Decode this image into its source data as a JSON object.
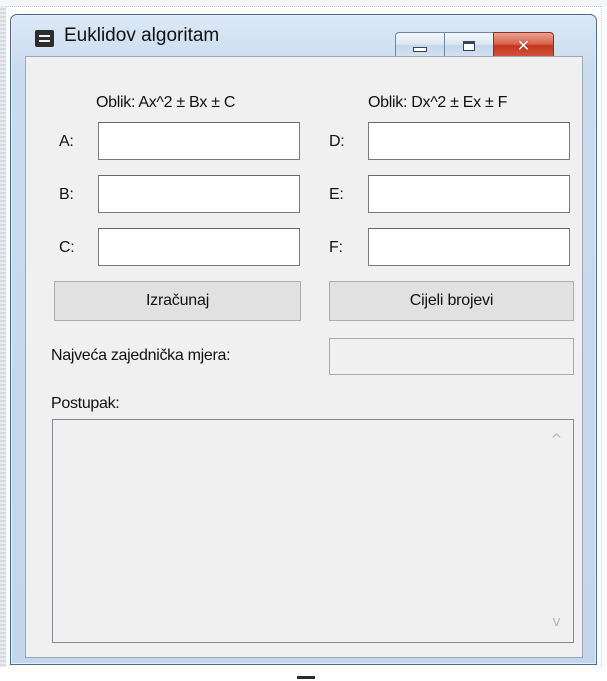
{
  "window": {
    "title": "Euklidov algoritam",
    "icons": {
      "app": "app-icon",
      "minimize": "minimize-icon",
      "maximize": "maximize-icon",
      "close": "close-icon"
    }
  },
  "labels": {
    "form_left": "Oblik: Ax^2 ± Bx ± C",
    "form_right": "Oblik: Dx^2 ± Ex ± F",
    "a": "A:",
    "b": "B:",
    "c": "C:",
    "d": "D:",
    "e": "E:",
    "f": "F:",
    "gcd": "Najveća zajednička mjera:",
    "steps": "Postupak:"
  },
  "inputs": {
    "a": "",
    "b": "",
    "c": "",
    "d": "",
    "e": "",
    "f": "",
    "gcd_result": "",
    "steps_text": ""
  },
  "buttons": {
    "calculate": "Izračunaj",
    "integers": "Cijeli brojevi"
  },
  "scrollbar": {
    "up": "^",
    "down": "v"
  },
  "colors": {
    "close_button": "#c4361d",
    "client_bg": "#f0f0f0",
    "frame": "#c3d6ec"
  }
}
